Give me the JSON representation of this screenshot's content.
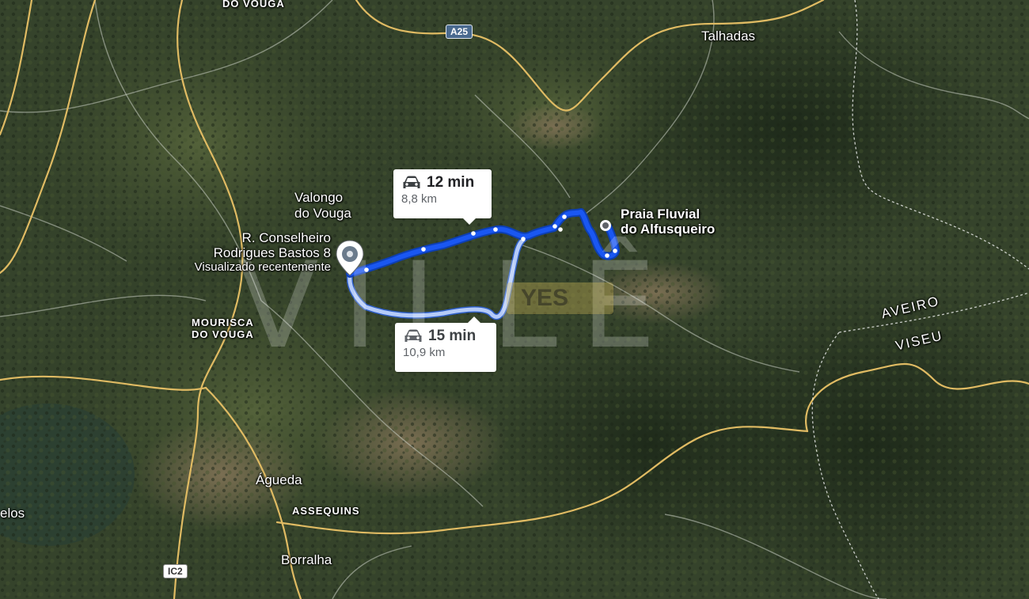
{
  "map": {
    "type": "satellite",
    "towns": [
      {
        "name": "DO VOUGA",
        "style": "small-caps"
      },
      {
        "name": "Talhadas",
        "style": "town"
      },
      {
        "name": "Valongo do Vouga",
        "line1": "Valongo",
        "line2": "do Vouga"
      },
      {
        "name": "MOURISCA DO VOUGA",
        "line1": "MOURISCA",
        "line2": "DO VOUGA"
      },
      {
        "name": "Águeda",
        "style": "town"
      },
      {
        "name": "ASSEQUINS",
        "style": "small-caps"
      },
      {
        "name": "Borralha",
        "style": "town"
      },
      {
        "name": "elos",
        "style": "town"
      }
    ],
    "regions": [
      "AVEIRO",
      "VISEU"
    ],
    "road_shields": [
      {
        "label": "A25",
        "kind": "motorway"
      },
      {
        "label": "IC2",
        "kind": "ic"
      }
    ],
    "origin": {
      "line1": "R. Conselheiro",
      "line2": "Rodrigues Bastos 8",
      "note": "Visualizado recentemente",
      "icon": "map-pin-icon"
    },
    "destination": {
      "line1": "Praia Fluvial",
      "line2": "do Alfusqueiro",
      "icon": "place-dot-icon"
    },
    "routes": [
      {
        "id": "primary",
        "time": "12 min",
        "distance": "8,8 km",
        "color": "#1a57f2",
        "selected": true,
        "icon": "car-icon"
      },
      {
        "id": "alternate",
        "time": "15 min",
        "distance": "10,9 km",
        "color": "#a9c2f7",
        "selected": false,
        "icon": "car-icon"
      }
    ],
    "watermark": "VILLÊ",
    "watermark_badge": "YES"
  }
}
